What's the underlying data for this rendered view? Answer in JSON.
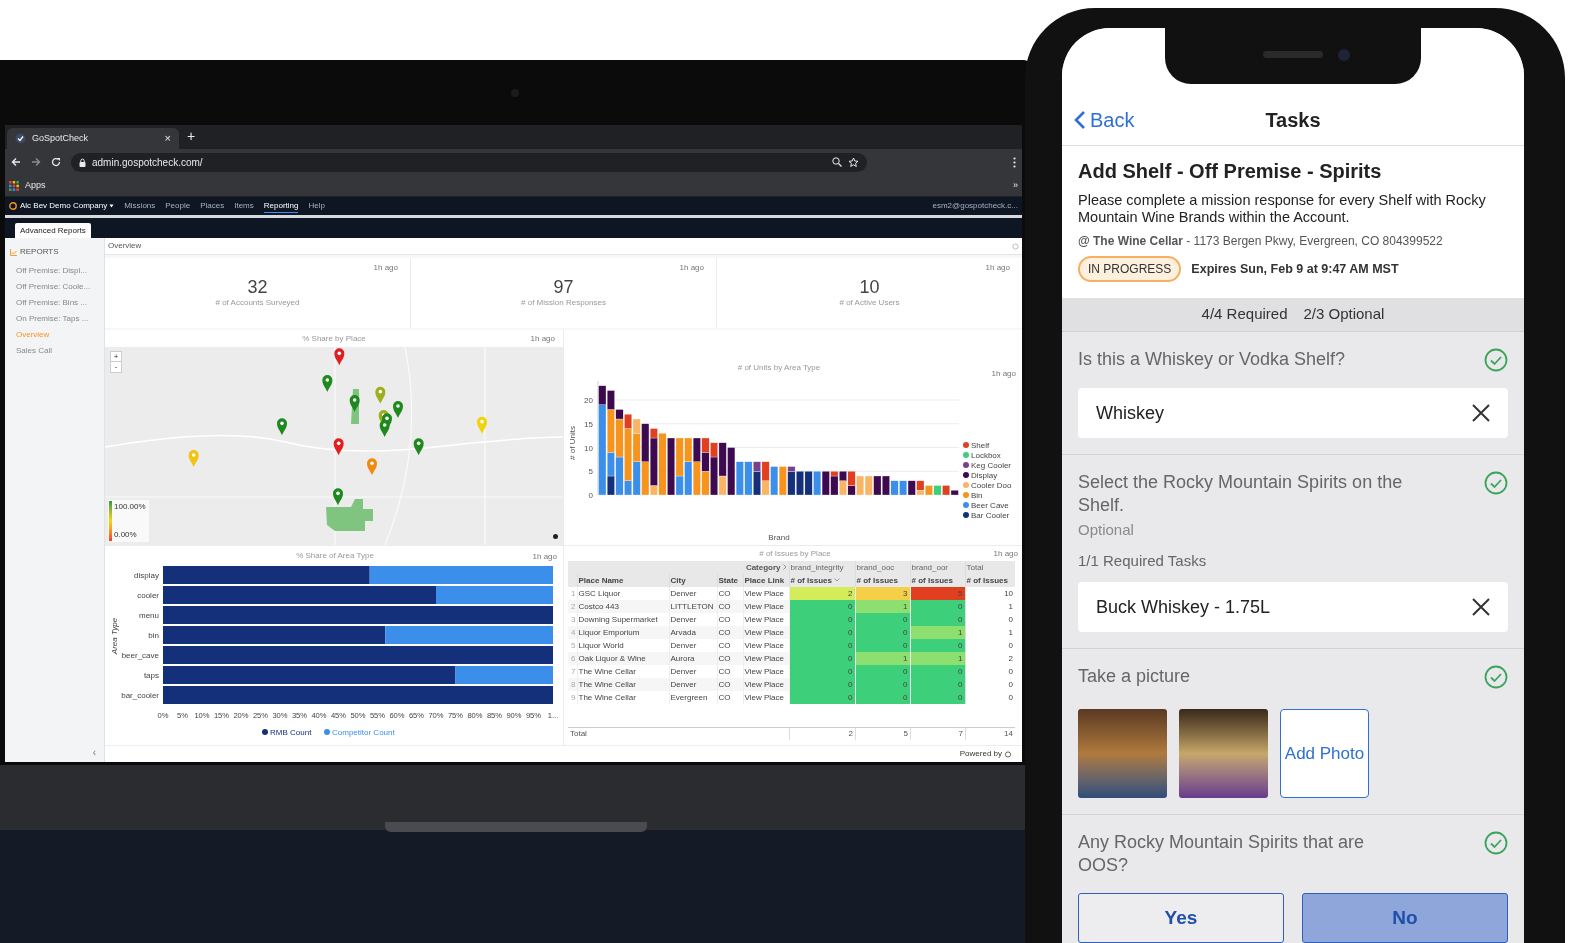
{
  "browser": {
    "tab_title": "GoSpotCheck",
    "tab_close": "×",
    "new_tab": "+",
    "url": "admin.gospotcheck.com/",
    "bookmarks": [
      "Apps"
    ],
    "overflow": "»"
  },
  "app_nav": {
    "company": "Alc Bev Demo Company",
    "items": [
      {
        "label": "Missions",
        "selected": false
      },
      {
        "label": "People",
        "selected": false
      },
      {
        "label": "Places",
        "selected": false
      },
      {
        "label": "Items",
        "selected": false
      },
      {
        "label": "Reporting",
        "selected": true
      },
      {
        "label": "Help",
        "selected": false
      }
    ],
    "user": "esm2@gospotcheck.c..."
  },
  "report_tabs": [
    {
      "label": "Advanced Reports",
      "selected": true
    }
  ],
  "sidebar": {
    "heading": "REPORTS",
    "items": [
      {
        "label": "Off Premise: Displ...",
        "selected": false
      },
      {
        "label": "Off Premise: Coole...",
        "selected": false
      },
      {
        "label": "Off Premise: Bins ...",
        "selected": false
      },
      {
        "label": "On Premise: Taps ...",
        "selected": false
      },
      {
        "label": "Overview",
        "selected": true
      },
      {
        "label": "Sales Call",
        "selected": false
      }
    ],
    "toggle": "‹"
  },
  "page_title": "Overview",
  "kpis": [
    {
      "value": "32",
      "label": "# of Accounts Surveyed",
      "updated": "1h ago"
    },
    {
      "value": "97",
      "label": "# of Mission Responses",
      "updated": "1h ago"
    },
    {
      "value": "10",
      "label": "# of Active Users",
      "updated": "1h ago"
    }
  ],
  "map": {
    "title": "% Share by Place",
    "updated": "1h ago",
    "zoom_in": "+",
    "zoom_out": "-",
    "legend_max": "100.00%",
    "legend_min": "0.00%"
  },
  "units_chart": {
    "updated": "1h ago",
    "chart_data": {
      "type": "bar",
      "title": "# of Units by Area Type",
      "xlabel": "Brand",
      "ylabel": "# of Units",
      "stacked": true,
      "grid": true,
      "legend": "right",
      "ylim": [
        0,
        24
      ],
      "yticks": [
        0,
        5,
        10,
        15,
        20
      ],
      "series": [
        {
          "name": "Shelf",
          "color": "#e0401f",
          "values": [
            0,
            0,
            0,
            3,
            0,
            0,
            2,
            0,
            0,
            0,
            0,
            0,
            3,
            3,
            0,
            0,
            0,
            0,
            0,
            4,
            0,
            0,
            0,
            0,
            0,
            0,
            0,
            1,
            0,
            3,
            0,
            0,
            0,
            0,
            0,
            0,
            0,
            2,
            0,
            0,
            2,
            0
          ]
        },
        {
          "name": "Lockbox",
          "color": "#3ecf7a",
          "values": [
            0,
            0,
            0,
            0,
            0,
            0,
            0,
            0,
            0,
            0,
            0,
            0,
            0,
            0,
            0,
            0,
            0,
            0,
            0,
            0,
            0,
            0,
            0,
            0,
            0,
            0,
            0,
            0,
            0,
            0,
            0,
            0,
            0,
            0,
            0,
            0,
            0,
            0,
            0,
            2,
            0,
            0
          ]
        },
        {
          "name": "Keg Cooler",
          "color": "#7b3f8c",
          "values": [
            0,
            0,
            0,
            0,
            0,
            0,
            0,
            0,
            0,
            0,
            0,
            0,
            0,
            0,
            0,
            0,
            0,
            0,
            2,
            0,
            0,
            0,
            1,
            0,
            0,
            0,
            0,
            0,
            0,
            0,
            0,
            0,
            0,
            0,
            0,
            0,
            0,
            0,
            0,
            0,
            0,
            0
          ]
        },
        {
          "name": "Display",
          "color": "#3d0a4f",
          "values": [
            4,
            4,
            2,
            0,
            0,
            8,
            10,
            0,
            12,
            0,
            0,
            5,
            4,
            8,
            7,
            10,
            0,
            0,
            0,
            0,
            0,
            0,
            0,
            0,
            0,
            0,
            5,
            4,
            2,
            2,
            0,
            0,
            4,
            4,
            0,
            0,
            3,
            0,
            0,
            0,
            0,
            1
          ]
        },
        {
          "name": "Cooler Doo",
          "color": "#f9b565",
          "values": [
            0,
            0,
            0,
            0,
            3,
            0,
            2,
            0,
            0,
            0,
            0,
            0,
            0,
            0,
            4,
            0,
            0,
            0,
            0,
            3,
            0,
            0,
            0,
            0,
            0,
            0,
            0,
            0,
            3,
            0,
            4,
            4,
            0,
            0,
            0,
            0,
            0,
            1,
            0,
            0,
            0,
            0
          ]
        },
        {
          "name": "Bin",
          "color": "#f7941d",
          "values": [
            0,
            9,
            8,
            11,
            6,
            7,
            0,
            13,
            0,
            8,
            5,
            7,
            5,
            0,
            0,
            0,
            0,
            0,
            0,
            0,
            0,
            6,
            0,
            0,
            0,
            0,
            0,
            0,
            0,
            0,
            0,
            0,
            0,
            0,
            0,
            0,
            0,
            0,
            2,
            0,
            0,
            0
          ]
        },
        {
          "name": "Beer Cave",
          "color": "#3b8fea",
          "values": [
            19,
            5,
            8,
            3,
            7,
            0,
            0,
            0,
            0,
            4,
            7,
            0,
            0,
            0,
            0,
            0,
            7,
            7,
            0,
            0,
            6,
            0,
            0,
            0,
            0,
            5,
            0,
            0,
            0,
            0,
            0,
            0,
            0,
            0,
            3,
            3,
            0,
            0,
            0,
            0,
            0,
            0
          ]
        },
        {
          "name": "Bar Cooler",
          "color": "#14307a",
          "values": [
            0,
            4,
            0,
            0,
            0,
            0,
            0,
            0,
            0,
            0,
            0,
            0,
            0,
            0,
            0,
            0,
            0,
            0,
            5,
            0,
            0,
            0,
            5,
            5,
            5,
            0,
            0,
            0,
            0,
            0,
            0,
            0,
            0,
            0,
            0,
            0,
            0,
            0,
            0,
            0,
            0,
            0
          ]
        }
      ]
    }
  },
  "share_chart": {
    "updated": "1h ago",
    "chart_data": {
      "type": "bar",
      "title": "% Share of Area Type",
      "ylabel": "Area Type",
      "orientation": "horizontal",
      "stacked": true,
      "legend": "bottom",
      "categories": [
        "display",
        "cooler",
        "menu",
        "bin",
        "beer_cave",
        "taps",
        "bar_cooler"
      ],
      "xlim": [
        0,
        100
      ],
      "xticks": [
        {
          "value": 0,
          "label": "0%"
        },
        {
          "value": 5,
          "label": "5%"
        },
        {
          "value": 10,
          "label": "10%"
        },
        {
          "value": 15,
          "label": "15%"
        },
        {
          "value": 20,
          "label": "20%"
        },
        {
          "value": 25,
          "label": "25%"
        },
        {
          "value": 30,
          "label": "30%"
        },
        {
          "value": 35,
          "label": "35%"
        },
        {
          "value": 40,
          "label": "40%"
        },
        {
          "value": 45,
          "label": "45%"
        },
        {
          "value": 50,
          "label": "50%"
        },
        {
          "value": 55,
          "label": "55%"
        },
        {
          "value": 60,
          "label": "60%"
        },
        {
          "value": 65,
          "label": "65%"
        },
        {
          "value": 70,
          "label": "70%"
        },
        {
          "value": 75,
          "label": "75%"
        },
        {
          "value": 80,
          "label": "80%"
        },
        {
          "value": 85,
          "label": "85%"
        },
        {
          "value": 90,
          "label": "90%"
        },
        {
          "value": 95,
          "label": "95%"
        },
        {
          "value": 100,
          "label": "1..."
        }
      ],
      "series": [
        {
          "name": "RMB Count",
          "color": "#14307a",
          "values": [
            53,
            70,
            100,
            57,
            100,
            75,
            100
          ]
        },
        {
          "name": "Competitor Count",
          "color": "#3b8fea",
          "values": [
            47,
            30,
            0,
            43,
            0,
            25,
            0
          ]
        }
      ]
    }
  },
  "issues_table": {
    "title": "# of Issues by Place",
    "updated": "1h ago",
    "category_label": "Category",
    "groups": [
      "brand_integrity",
      "brand_ooc",
      "brand_oor",
      "Total"
    ],
    "columns": [
      "Place Name",
      "City",
      "State",
      "Place Link",
      "# of Issues",
      "# of Issues",
      "# of Issues",
      "# of Issues"
    ],
    "rows": [
      {
        "index": "1",
        "place": "GSC Liquor",
        "city": "Denver",
        "state": "CO",
        "link": "View Place",
        "cells": [
          {
            "text": "2",
            "color": "#d4ec5a"
          },
          {
            "text": "3",
            "color": "#f5cf48"
          },
          {
            "text": "5",
            "color": "#e0401f"
          }
        ],
        "total": "10"
      },
      {
        "index": "2",
        "place": "Costco 443",
        "city": "LITTLETON",
        "state": "CO",
        "link": "View Place",
        "cells": [
          {
            "text": "0",
            "color": "#3ecf7a"
          },
          {
            "text": "1",
            "color": "#8ddf70"
          },
          {
            "text": "0",
            "color": "#3ecf7a"
          }
        ],
        "total": "1"
      },
      {
        "index": "3",
        "place": "Downing Supermarket",
        "city": "Denver",
        "state": "CO",
        "link": "View Place",
        "cells": [
          {
            "text": "0",
            "color": "#3ecf7a"
          },
          {
            "text": "0",
            "color": "#3ecf7a"
          },
          {
            "text": "0",
            "color": "#3ecf7a"
          }
        ],
        "total": "0"
      },
      {
        "index": "4",
        "place": "Liquor Emporium",
        "city": "Arvada",
        "state": "CO",
        "link": "View Place",
        "cells": [
          {
            "text": "0",
            "color": "#3ecf7a"
          },
          {
            "text": "0",
            "color": "#3ecf7a"
          },
          {
            "text": "1",
            "color": "#8ddf70"
          }
        ],
        "total": "1"
      },
      {
        "index": "5",
        "place": "Liquor World",
        "city": "Denver",
        "state": "CO",
        "link": "View Place",
        "cells": [
          {
            "text": "0",
            "color": "#3ecf7a"
          },
          {
            "text": "0",
            "color": "#3ecf7a"
          },
          {
            "text": "0",
            "color": "#3ecf7a"
          }
        ],
        "total": "0"
      },
      {
        "index": "6",
        "place": "Oak Liquor & Wine",
        "city": "Aurora",
        "state": "CO",
        "link": "View Place",
        "cells": [
          {
            "text": "0",
            "color": "#3ecf7a"
          },
          {
            "text": "1",
            "color": "#8ddf70"
          },
          {
            "text": "1",
            "color": "#8ddf70"
          }
        ],
        "total": "2"
      },
      {
        "index": "7",
        "place": "The Wine Cellar",
        "city": "Denver",
        "state": "CO",
        "link": "View Place",
        "cells": [
          {
            "text": "0",
            "color": "#3ecf7a"
          },
          {
            "text": "0",
            "color": "#3ecf7a"
          },
          {
            "text": "0",
            "color": "#3ecf7a"
          }
        ],
        "total": "0"
      },
      {
        "index": "8",
        "place": "The Wine Cellar",
        "city": "Denver",
        "state": "CO",
        "link": "View Place",
        "cells": [
          {
            "text": "0",
            "color": "#3ecf7a"
          },
          {
            "text": "0",
            "color": "#3ecf7a"
          },
          {
            "text": "0",
            "color": "#3ecf7a"
          }
        ],
        "total": "0"
      },
      {
        "index": "9",
        "place": "The Wine Cellar",
        "city": "Evergreen",
        "state": "CO",
        "link": "View Place",
        "cells": [
          {
            "text": "0",
            "color": "#3ecf7a"
          },
          {
            "text": "0",
            "color": "#3ecf7a"
          },
          {
            "text": "0",
            "color": "#3ecf7a"
          }
        ],
        "total": "0"
      }
    ],
    "total_label": "Total",
    "totals": [
      "2",
      "5",
      "7",
      "14"
    ]
  },
  "footer": "Powered by",
  "phone": {
    "back": "Back",
    "title": "Tasks",
    "mission": {
      "title": "Add Shelf - Off Premise - Spirits",
      "description": "Please complete a mission response for every Shelf with Rocky Mountain Wine Brands within the Account.",
      "location": "**@ The Wine Cellar** - 1173 Bergen Pkwy, Evergreen, CO 804399522",
      "status": "IN PROGRESS",
      "expires": "Expires Sun, Feb 9 at 9:47 AM MST"
    },
    "progress": [
      "4/4 Required",
      "2/3 Optional"
    ],
    "tasks": [
      {
        "kind": "text",
        "question": "Is this a Whiskey or Vodka Shelf?",
        "complete": true,
        "answer": "Whiskey"
      },
      {
        "kind": "list",
        "question": "Select the Rocky Mountain Spirits on the Shelf.",
        "complete": true,
        "note": "Optional",
        "required": "1/1 Required Tasks",
        "answer": "Buck Whiskey - 1.75L"
      },
      {
        "kind": "photo",
        "question": "Take a picture",
        "complete": true,
        "add_label": "Add Photo"
      },
      {
        "kind": "choice",
        "question": "Any Rocky Mountain Spirits that are OOS?",
        "complete": true,
        "options": [
          {
            "label": "Yes",
            "selected": false
          },
          {
            "label": "No",
            "selected": true
          }
        ]
      }
    ]
  }
}
